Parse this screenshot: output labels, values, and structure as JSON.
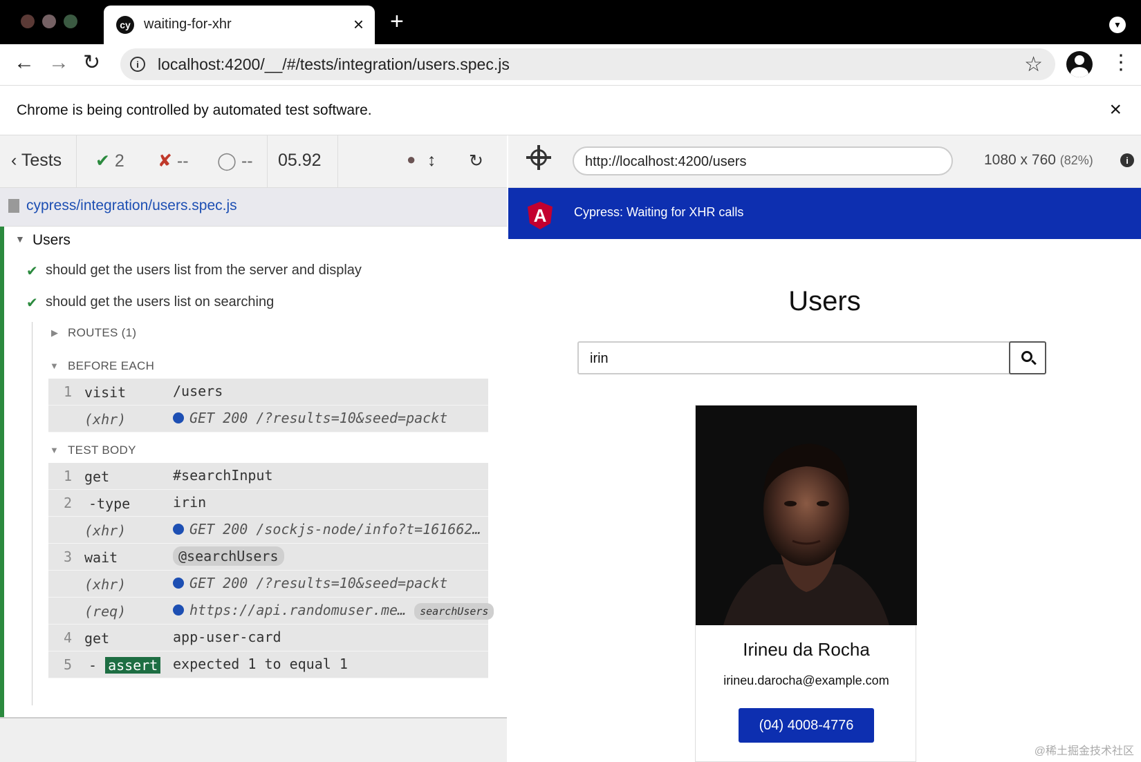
{
  "browser": {
    "tab_title": "waiting-for-xhr",
    "tab_icon_text": "cy",
    "url": "localhost:4200/__/#/tests/integration/users.spec.js",
    "infobar_message": "Chrome is being controlled by automated test software.",
    "colors": {
      "close_dot": "#5b3a36",
      "min_dot": "#756164",
      "max_dot": "#3b5a42"
    }
  },
  "runner": {
    "tests_label": "Tests",
    "passed_count": "2",
    "failed_count": "--",
    "pending_count": "--",
    "duration": "05.92",
    "spec_path": "cypress/integration/users.spec.js",
    "suite_title": "Users",
    "tests": [
      {
        "title": "should get the users list from the server and display",
        "state": "passed"
      },
      {
        "title": "should get the users list on searching",
        "state": "passed"
      }
    ],
    "routes_label": "ROUTES (1)",
    "before_each_label": "BEFORE EACH",
    "before_each": [
      {
        "num": "1",
        "name": "visit",
        "message": "/users"
      },
      {
        "num": "",
        "name": "(xhr)",
        "message": "GET 200 /?results=10&seed=packt"
      }
    ],
    "test_body_label": "TEST BODY",
    "test_body": [
      {
        "num": "1",
        "name": "get",
        "message": "#searchInput"
      },
      {
        "num": "2",
        "name": "-type",
        "message": "irin"
      },
      {
        "num": "",
        "name": "(xhr)",
        "message": "GET 200 /sockjs-node/info?t=161662…"
      },
      {
        "num": "3",
        "name": "wait",
        "message": "@searchUsers"
      },
      {
        "num": "",
        "name": "(xhr)",
        "message": "GET 200 /?results=10&seed=packt"
      },
      {
        "num": "",
        "name": "(req)",
        "message": "https://api.randomuser.me…",
        "alias": "searchUsers"
      },
      {
        "num": "4",
        "name": "get",
        "message": "app-user-card"
      },
      {
        "num": "5",
        "name": "assert",
        "message": "expected  1  to equal  1"
      }
    ]
  },
  "preview": {
    "url": "http://localhost:4200/users",
    "viewport": "1080 x 760",
    "scale": "(82%)",
    "app_header": "Cypress: Waiting for XHR calls",
    "page_title": "Users",
    "search_value": "irin",
    "user": {
      "name": "Irineu da Rocha",
      "email": "irineu.darocha@example.com",
      "phone": "(04) 4008-4776"
    },
    "accent_color": "#0d2fb0"
  },
  "watermark": "@稀土掘金技术社区"
}
